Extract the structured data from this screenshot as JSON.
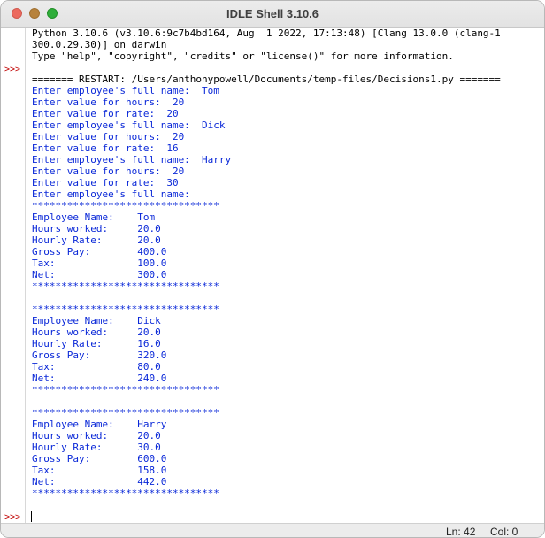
{
  "window": {
    "title": "IDLE Shell 3.10.6"
  },
  "prompts": [
    ">>>",
    ">>>"
  ],
  "shell_lines": [
    "Python 3.10.6 (v3.10.6:9c7b4bd164, Aug  1 2022, 17:13:48) [Clang 13.0.0 (clang-1",
    "300.0.29.30)] on darwin",
    "Type \"help\", \"copyright\", \"credits\" or \"license()\" for more information.",
    "",
    "======= RESTART: /Users/anthonypowell/Documents/temp-files/Decisions1.py =======",
    "Enter employee's full name:  Tom",
    "Enter value for hours:  20",
    "Enter value for rate:  20",
    "Enter employee's full name:  Dick",
    "Enter value for hours:  20",
    "Enter value for rate:  16",
    "Enter employee's full name:  Harry",
    "Enter value for hours:  20",
    "Enter value for rate:  30",
    "Enter employee's full name:",
    "********************************",
    "Employee Name:    Tom",
    "Hours worked:     20.0",
    "Hourly Rate:      20.0",
    "Gross Pay:        400.0",
    "Tax:              100.0",
    "Net:              300.0",
    "********************************",
    "",
    "********************************",
    "Employee Name:    Dick",
    "Hours worked:     20.0",
    "Hourly Rate:      16.0",
    "Gross Pay:        320.0",
    "Tax:              80.0",
    "Net:              240.0",
    "********************************",
    "",
    "********************************",
    "Employee Name:    Harry",
    "Hours worked:     20.0",
    "Hourly Rate:      30.0",
    "Gross Pay:        600.0",
    "Tax:              158.0",
    "Net:              442.0",
    "********************************"
  ],
  "statusbar": {
    "line": "Ln: 42",
    "col": "Col: 0"
  },
  "colors": {
    "output_blue": "#0a28d8",
    "prompt_red": "#c00000",
    "text_black": "#000000"
  }
}
